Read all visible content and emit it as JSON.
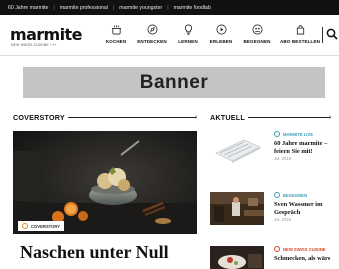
{
  "topbar": {
    "links": [
      "60 Jahre marmite",
      "marmite professional",
      "marmite youngster",
      "marmite foodlab"
    ]
  },
  "header": {
    "logo": "marmite",
    "tagline": "NEW SWISS CUISINE +++",
    "nav": [
      {
        "label": "KOCHEN",
        "icon": "pot-icon"
      },
      {
        "label": "ENTDECKEN",
        "icon": "compass-icon"
      },
      {
        "label": "LERNEN",
        "icon": "lightbulb-icon"
      },
      {
        "label": "ERLEBEN",
        "icon": "play-icon"
      },
      {
        "label": "BEGEGNEN",
        "icon": "people-icon"
      },
      {
        "label": "ABO BESTELLEN",
        "icon": "bag-icon"
      }
    ],
    "search_icon": "search-icon"
  },
  "banner": {
    "text": "Banner"
  },
  "coverstory": {
    "heading": "COVERSTORY",
    "tag": "COVERSTORY",
    "title": "Naschen unter Null"
  },
  "aktuell": {
    "heading": "AKTUELL",
    "items": [
      {
        "category": "MARMITE LIVE",
        "title": "60 Jahre marmite – feiern Sie mit!",
        "date": "Jul. 2019",
        "color": "#3aa0b5"
      },
      {
        "category": "BEGEGNEN",
        "title": "Sven Wassmer im Gespräch",
        "date": "Jul. 2019",
        "color": "#3aa0b5"
      },
      {
        "category": "NEW SWISS CUISINE",
        "title": "Schmecken, als wärs",
        "date": "",
        "color": "#d9452b"
      }
    ]
  }
}
